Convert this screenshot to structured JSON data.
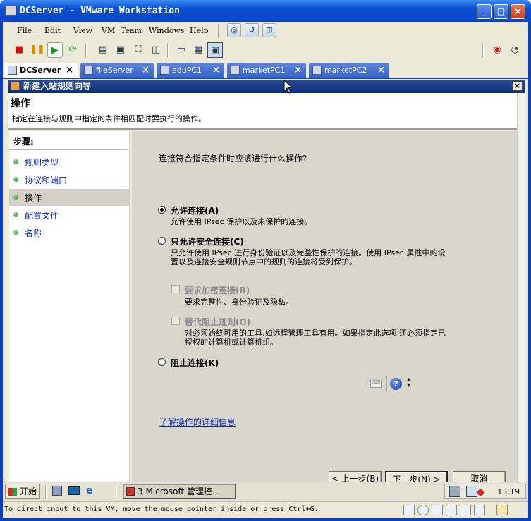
{
  "window": {
    "title": "DCServer - VMware Workstation",
    "buttons": {
      "minimize": "_",
      "maximize": "□",
      "close": "×"
    }
  },
  "menu": {
    "items": [
      "File",
      "Edit",
      "View",
      "VM",
      "Team",
      "Windows",
      "Help"
    ]
  },
  "tabs": [
    {
      "label": "DCServer",
      "active": true
    },
    {
      "label": "fileServer",
      "active": false
    },
    {
      "label": "eduPC1",
      "active": false
    },
    {
      "label": "marketPC1",
      "active": false
    },
    {
      "label": "marketPC2",
      "active": false
    }
  ],
  "wizard": {
    "title": "新建入站规则向导",
    "header_title": "操作",
    "header_subtitle": "指定在连接与规则中指定的条件相匹配时要执行的操作。",
    "steps_header": "步骤:",
    "steps": [
      {
        "label": "规则类型",
        "current": false
      },
      {
        "label": "协议和端口",
        "current": false
      },
      {
        "label": "操作",
        "current": true
      },
      {
        "label": "配置文件",
        "current": false
      },
      {
        "label": "名称",
        "current": false
      }
    ],
    "question": "连接符合指定条件时应该进行什么操作?",
    "options": {
      "allow": {
        "label": "允许连接(A)",
        "desc": "允许使用 IPsec 保护以及未保护的连接。",
        "selected": true
      },
      "secure": {
        "label": "只允许安全连接(C)",
        "desc_line1": "只允许使用 IPsec 进行身份验证以及完整性保护的连接。使用 IPsec 属性中的设",
        "desc_line2": "置以及连接安全规则节点中的规则的连接将受到保护。",
        "selected": false
      },
      "encrypt": {
        "label": "要求加密连接(R)",
        "desc": "要求完整性、身份验证及隐私。"
      },
      "override": {
        "label": "替代阻止规则(O)",
        "desc_line1": "对必须始终可用的工具,如远程管理工具有用。如果指定此选项,还必须指定已",
        "desc_line2": "授权的计算机或计算机组。"
      },
      "block": {
        "label": "阻止连接(K)",
        "selected": false
      }
    },
    "learn_more": "了解操作的详细信息",
    "buttons": {
      "back": "< 上一步(B)",
      "next": "下一步(N) >",
      "cancel": "取消"
    }
  },
  "taskbar": {
    "start": "开始",
    "task": "3 Microsoft 管理控...",
    "clock": "13:19"
  },
  "status": {
    "text": "To direct input to this VM, move the mouse pointer inside or press Ctrl+G."
  }
}
